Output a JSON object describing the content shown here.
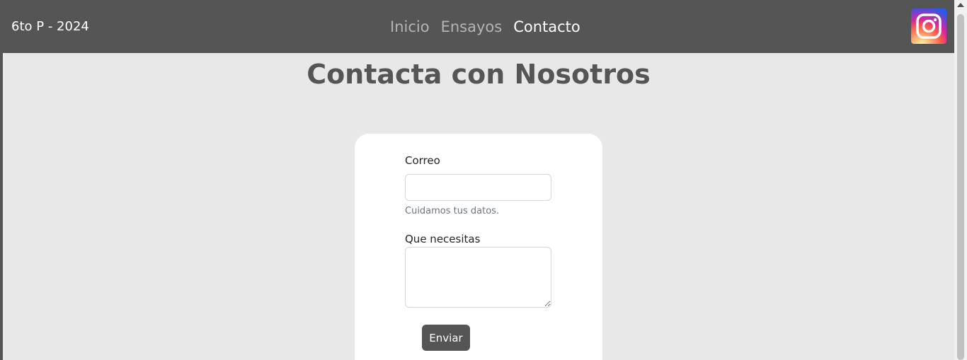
{
  "navbar": {
    "brand": "6to P - 2024",
    "links": [
      {
        "label": "Inicio",
        "active": false
      },
      {
        "label": "Ensayos",
        "active": false
      },
      {
        "label": "Contacto",
        "active": true
      }
    ],
    "social_icon": "instagram-icon"
  },
  "main": {
    "title": "Contacta con Nosotros"
  },
  "form": {
    "email_label": "Correo",
    "email_value": "",
    "email_help": "Cuidamos tus datos.",
    "message_label": "Que necesitas",
    "message_value": "",
    "submit_label": "Enviar"
  },
  "colors": {
    "navbar_bg": "#555555",
    "page_bg": "#e8e8e8",
    "card_bg": "#ffffff",
    "nav_inactive": "#b4b4b4",
    "nav_active": "#ffffff",
    "button_bg": "#555555"
  }
}
